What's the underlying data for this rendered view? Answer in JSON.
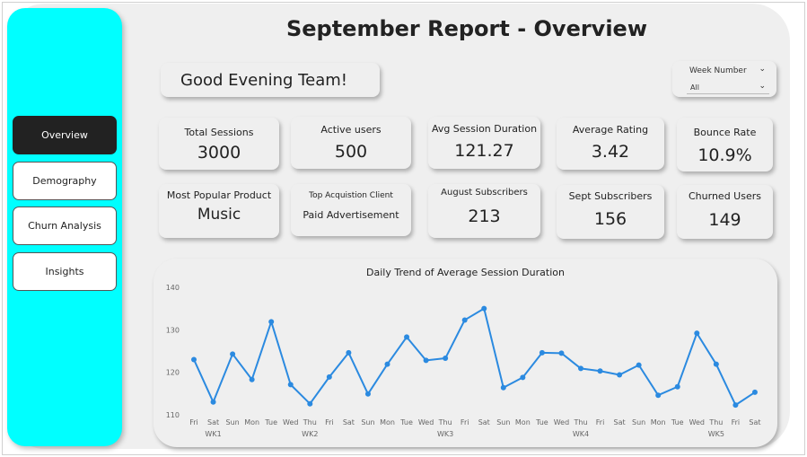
{
  "title": "September Report - Overview",
  "greeting": "Good Evening Team!",
  "slicer": {
    "label": "Week Number",
    "value": "All"
  },
  "nav": [
    {
      "label": "Overview",
      "active": true
    },
    {
      "label": "Demography",
      "active": false
    },
    {
      "label": "Churn Analysis",
      "active": false
    },
    {
      "label": "Insights",
      "active": false
    }
  ],
  "kpis": {
    "total_sessions": {
      "label": "Total Sessions",
      "value": "3000"
    },
    "active_users": {
      "label": "Active users",
      "value": "500"
    },
    "avg_session_duration": {
      "label": "Avg Session Duration",
      "value": "121.27"
    },
    "average_rating": {
      "label": "Average Rating",
      "value": "3.42"
    },
    "bounce_rate": {
      "label": "Bounce Rate",
      "value": "10.9%"
    },
    "popular_product": {
      "label": "Most Popular Product",
      "value": "Music"
    },
    "acquisition_client": {
      "label": "Top Acquistion Client",
      "value": "Paid Advertisement"
    },
    "august_subscribers": {
      "label": "August Subscribers",
      "value": "213"
    },
    "sept_subscribers": {
      "label": "Sept Subscribers",
      "value": "156"
    },
    "churned_users": {
      "label": "Churned Users",
      "value": "149"
    }
  },
  "colors": {
    "sidebar": "#00ffff",
    "line": "#2b8ae0",
    "active_nav": "#222222"
  },
  "chart_data": {
    "type": "line",
    "title": "Daily Trend of Average Session Duration",
    "xlabel": "",
    "ylabel": "",
    "ylim": [
      110,
      140
    ],
    "yticks": [
      110,
      120,
      130,
      140
    ],
    "grid": false,
    "categories": [
      "Fri",
      "Sat",
      "Sun",
      "Mon",
      "Tue",
      "Wed",
      "Thu",
      "Fri",
      "Sat",
      "Sun",
      "Mon",
      "Tue",
      "Wed",
      "Thu",
      "Fri",
      "Sat",
      "Sun",
      "Mon",
      "Tue",
      "Wed",
      "Thu",
      "Fri",
      "Sat",
      "Sun",
      "Mon",
      "Tue",
      "Wed",
      "Thu",
      "Fri",
      "Sat"
    ],
    "week_labels": [
      {
        "label": "WK1",
        "index": 1
      },
      {
        "label": "WK2",
        "index": 6
      },
      {
        "label": "WK3",
        "index": 13
      },
      {
        "label": "WK4",
        "index": 20
      },
      {
        "label": "WK5",
        "index": 27
      }
    ],
    "series": [
      {
        "values": [
          123,
          113,
          124.3,
          118.3,
          131.9,
          117.1,
          112.6,
          118.9,
          124.6,
          114.9,
          121.9,
          128.3,
          122.8,
          123.3,
          132.3,
          135,
          116.4,
          118.8,
          124.6,
          124.5,
          120.9,
          120.3,
          119.4,
          121.7,
          114.6,
          116.6,
          129.2,
          121.9,
          112.3,
          115.3
        ]
      }
    ]
  }
}
